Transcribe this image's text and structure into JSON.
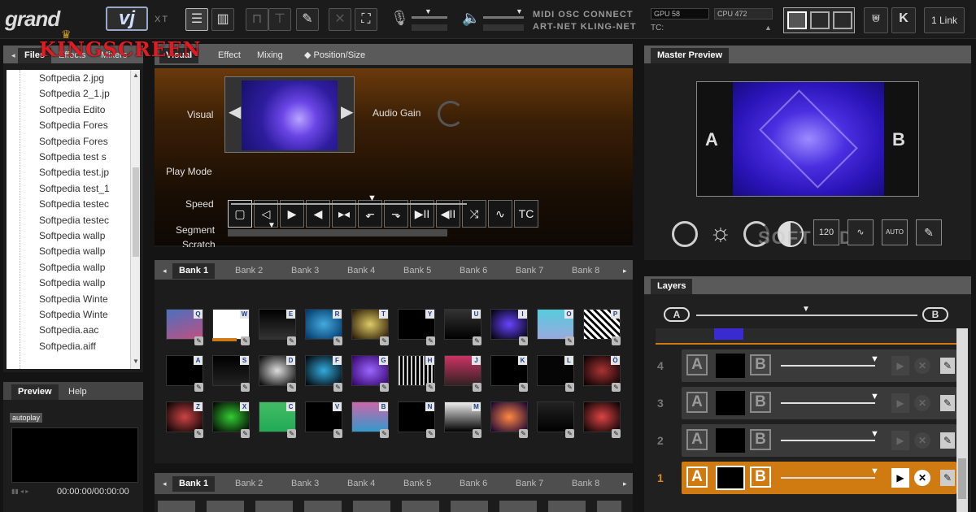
{
  "app": {
    "logo_main": "grand",
    "logo_vj": "vj",
    "logo_suffix": "XT",
    "watermark": "KINGSCREEN"
  },
  "topbar": {
    "protocols_line1": "MIDI  OSC  CONNECT",
    "protocols_line2": "ART-NET  KLING-NET",
    "gpu_label": "GPU 58",
    "cpu_label": "CPU 472",
    "tc_label": "TC:",
    "link_button": "1 Link"
  },
  "files_panel": {
    "tabs": [
      "Files",
      "Effects",
      "Mixers"
    ],
    "items": [
      "Softpedia 2.jpg",
      "Softpedia 2_1.jp",
      "Softpedia Edito",
      "Softpedia Fores",
      "Softpedia Fores",
      "Softpedia test s",
      "Softpedia test.jp",
      "Softpedia test_1",
      "Softpedia testec",
      "Softpedia testec",
      "Softpedia wallp",
      "Softpedia wallp",
      "Softpedia wallp",
      "Softpedia wallp",
      "Softpedia Winte",
      "Softpedia Winte",
      "Softpedia.aac",
      "Softpedia.aiff"
    ]
  },
  "preview_panel": {
    "tabs": [
      "Preview",
      "Help"
    ],
    "autoplay": "autoplay",
    "timecode": "00:00:00/00:00:00"
  },
  "visual_panel": {
    "tabs": [
      "Visual",
      "Effect",
      "Mixing",
      "Position/Size"
    ],
    "visual_label": "Visual",
    "audio_gain_label": "Audio Gain",
    "play_mode_label": "Play Mode",
    "speed_label": "Speed",
    "segment_label": "Segment",
    "scratch_label": "Scratch",
    "play_buttons": [
      "▢",
      "◁",
      "▶",
      "◀",
      "▸◂",
      "⬐",
      "⬎",
      "▶II",
      "◀II",
      "⤨",
      "∿",
      "TC"
    ],
    "speed_level": 0.6,
    "segment_level": 0.2
  },
  "banks": {
    "tabs": [
      "Bank 1",
      "Bank 2",
      "Bank 3",
      "Bank 4",
      "Bank 5",
      "Bank 6",
      "Bank 7",
      "Bank 8"
    ],
    "clip_keys": [
      [
        "Q",
        "W",
        "E",
        "R",
        "T",
        "Y",
        "U",
        "I",
        "O",
        "P"
      ],
      [
        "A",
        "S",
        "D",
        "F",
        "G",
        "H",
        "J",
        "K",
        "L",
        "Ö"
      ],
      [
        "Z",
        "X",
        "C",
        "V",
        "B",
        "N",
        "M",
        "",
        "",
        ""
      ]
    ]
  },
  "master_preview": {
    "title": "Master Preview",
    "side_a": "A",
    "side_b": "B",
    "bpm_button": "120",
    "auto_button": "AUTO",
    "watermark": "SOFTPEDIA"
  },
  "layers": {
    "title": "Layers",
    "crossfader_a": "A",
    "crossfader_b": "B",
    "rows": [
      {
        "num": "4",
        "a": "A",
        "b": "B"
      },
      {
        "num": "3",
        "a": "A",
        "b": "B"
      },
      {
        "num": "2",
        "a": "A",
        "b": "B"
      },
      {
        "num": "1",
        "a": "A",
        "b": "B"
      }
    ]
  },
  "colors": {
    "accent": "#d07a12",
    "panel": "#1d1d1d",
    "tabstrip": "#5a5a5a"
  }
}
